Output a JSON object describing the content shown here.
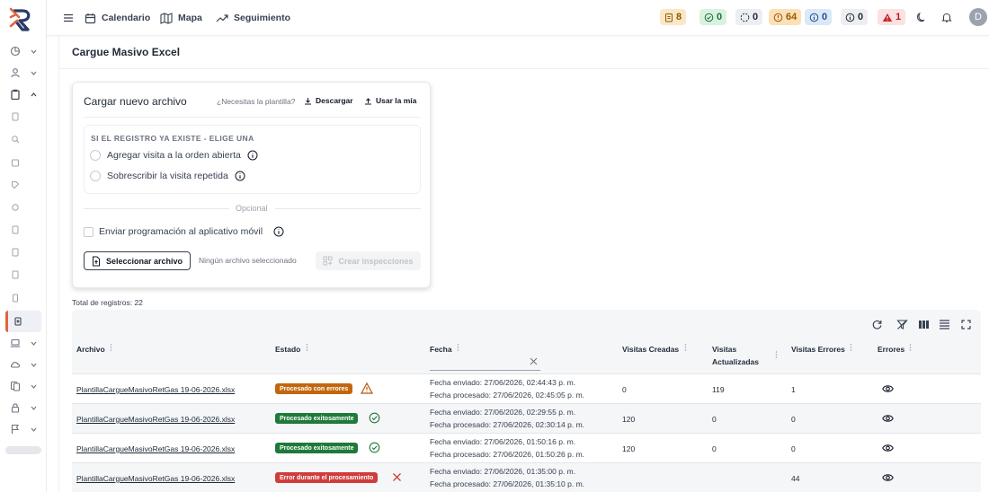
{
  "header": {
    "nav": [
      {
        "label": "Calendario",
        "icon": "calendar-icon"
      },
      {
        "label": "Mapa",
        "icon": "map-icon"
      },
      {
        "label": "Seguimiento",
        "icon": "trending-up-icon"
      }
    ],
    "counters": [
      {
        "value": "8",
        "icon": "clipboard-icon",
        "bg": "#fbe7c6",
        "fg": "#8a5a00"
      },
      {
        "value": "0",
        "icon": "check-circle-icon",
        "bg": "#d9f2df",
        "fg": "#1f6f3a"
      },
      {
        "value": "0",
        "icon": "loading-icon",
        "bg": "#eceef1",
        "fg": "#1f2937"
      },
      {
        "value": "64",
        "icon": "alert-square-icon",
        "bg": "#fbe0b8",
        "fg": "#9a5a00"
      },
      {
        "value": "0",
        "icon": "info-circle-icon",
        "bg": "#dbe8f7",
        "fg": "#1f4e8a"
      },
      {
        "value": "0",
        "icon": "info-circle-icon",
        "bg": "#eceef1",
        "fg": "#1f2937"
      },
      {
        "value": "1",
        "icon": "warning-triangle-icon",
        "bg": "#fbe1e1",
        "fg": "#b91c1c"
      }
    ],
    "avatar_initial": "D"
  },
  "page": {
    "title": "Cargue Masivo Excel"
  },
  "upload_card": {
    "title": "Cargar nuevo archivo",
    "need_template": "¿Necesitas la plantilla?",
    "download_label": "Descargar",
    "use_mine_label": "Usar la mía",
    "options_title": "SI EL REGISTRO YA EXISTE - ELIGE UNA",
    "option_add": "Agregar visita a la orden abierta",
    "option_overwrite": "Sobrescribir la visita repetida",
    "optional_label": "Opcional",
    "send_schedule_label": "Enviar programación al aplicativo móvil",
    "select_file_label": "Seleccionar archivo",
    "no_file_label": "Ningún archivo seleccionado",
    "create_label": "Crear inspecciones"
  },
  "records": {
    "total_label": "Total de registros: 22",
    "columns": {
      "archivo": "Archivo",
      "estado": "Estado",
      "fecha": "Fecha",
      "creadas": "Visitas Creadas",
      "actualizadas_1": "Visitas",
      "actualizadas_2": "Actualizadas",
      "errores_count": "Visitas Errores",
      "errores": "Errores"
    },
    "rows": [
      {
        "file": "PlantillaCargueMasivoRetGas 19-06-2026.xlsx",
        "status": "Procesado con errores",
        "status_bg": "#c2660d",
        "status_icon": "warning-icon",
        "sent": "Fecha enviado: 27/06/2026, 02:44:43 p. m.",
        "processed": "Fecha procesado: 27/06/2026, 02:45:05 p. m.",
        "created": "0",
        "updated": "119",
        "errors": "1"
      },
      {
        "file": "PlantillaCargueMasivoRetGas 19-06-2026.xlsx",
        "status": "Procesado exitosamente",
        "status_bg": "#1f7a3a",
        "status_icon": "check-icon",
        "sent": "Fecha enviado: 27/06/2026, 02:29:55 p. m.",
        "processed": "Fecha procesado: 27/06/2026, 02:30:14 p. m.",
        "created": "120",
        "updated": "0",
        "errors": "0"
      },
      {
        "file": "PlantillaCargueMasivoRetGas 19-06-2026.xlsx",
        "status": "Procesado exitosamente",
        "status_bg": "#1f7a3a",
        "status_icon": "check-icon",
        "sent": "Fecha enviado: 27/06/2026, 01:50:16 p. m.",
        "processed": "Fecha procesado: 27/06/2026, 01:50:26 p. m.",
        "created": "120",
        "updated": "0",
        "errors": "0"
      },
      {
        "file": "PlantillaCargueMasivoRetGas 19-06-2026.xlsx",
        "status": "Error durante el procesamiento",
        "status_bg": "#d03c3c",
        "status_icon": "x-icon",
        "sent": "Fecha enviado: 27/06/2026, 01:35:00 p. m.",
        "processed": "Fecha procesado: 27/06/2026, 01:35:10 p. m.",
        "created": "",
        "updated": "",
        "errors": "44"
      }
    ]
  }
}
